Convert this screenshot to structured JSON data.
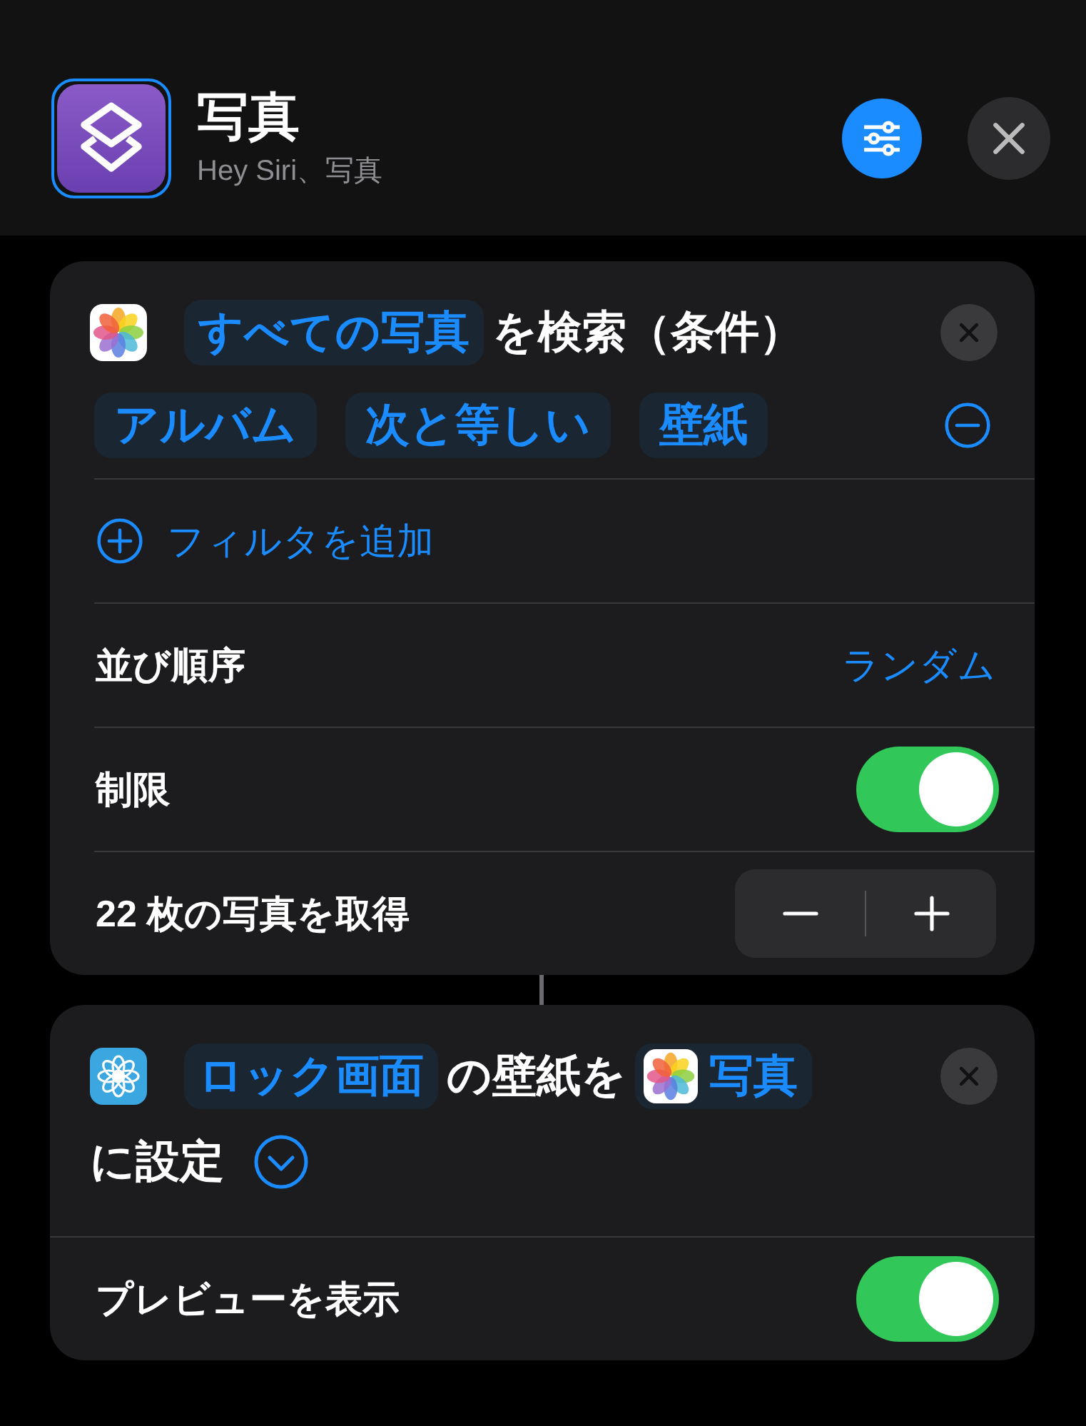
{
  "header": {
    "title": "写真",
    "subtitle": "Hey Siri、写真"
  },
  "actions": [
    {
      "kind": "find",
      "lines": [
        [
          {
            "kind": "token",
            "text": "すべての写真"
          },
          {
            "kind": "text",
            "text": "を検索（条件）"
          }
        ]
      ],
      "filters": [
        {
          "chips": [
            "アルバム",
            "次と等しい",
            "壁紙"
          ]
        }
      ],
      "add_filter": "フィルタを追加",
      "rows": [
        {
          "kind": "value",
          "label": "並び順序",
          "value": "ランダム"
        },
        {
          "kind": "toggle",
          "label": "制限",
          "on": true
        },
        {
          "kind": "stepper",
          "label": "22 枚の写真を取得"
        }
      ]
    },
    {
      "kind": "set",
      "lines": [
        [
          {
            "kind": "token",
            "text": "ロック画面"
          },
          {
            "kind": "text",
            "text": "の壁紙を"
          },
          {
            "kind": "app-token",
            "text": "写真"
          }
        ],
        [
          {
            "kind": "text",
            "text": "に設定"
          },
          {
            "kind": "chevron"
          }
        ]
      ],
      "rows": [
        {
          "kind": "toggle",
          "label": "プレビューを表示",
          "on": true
        }
      ]
    }
  ]
}
